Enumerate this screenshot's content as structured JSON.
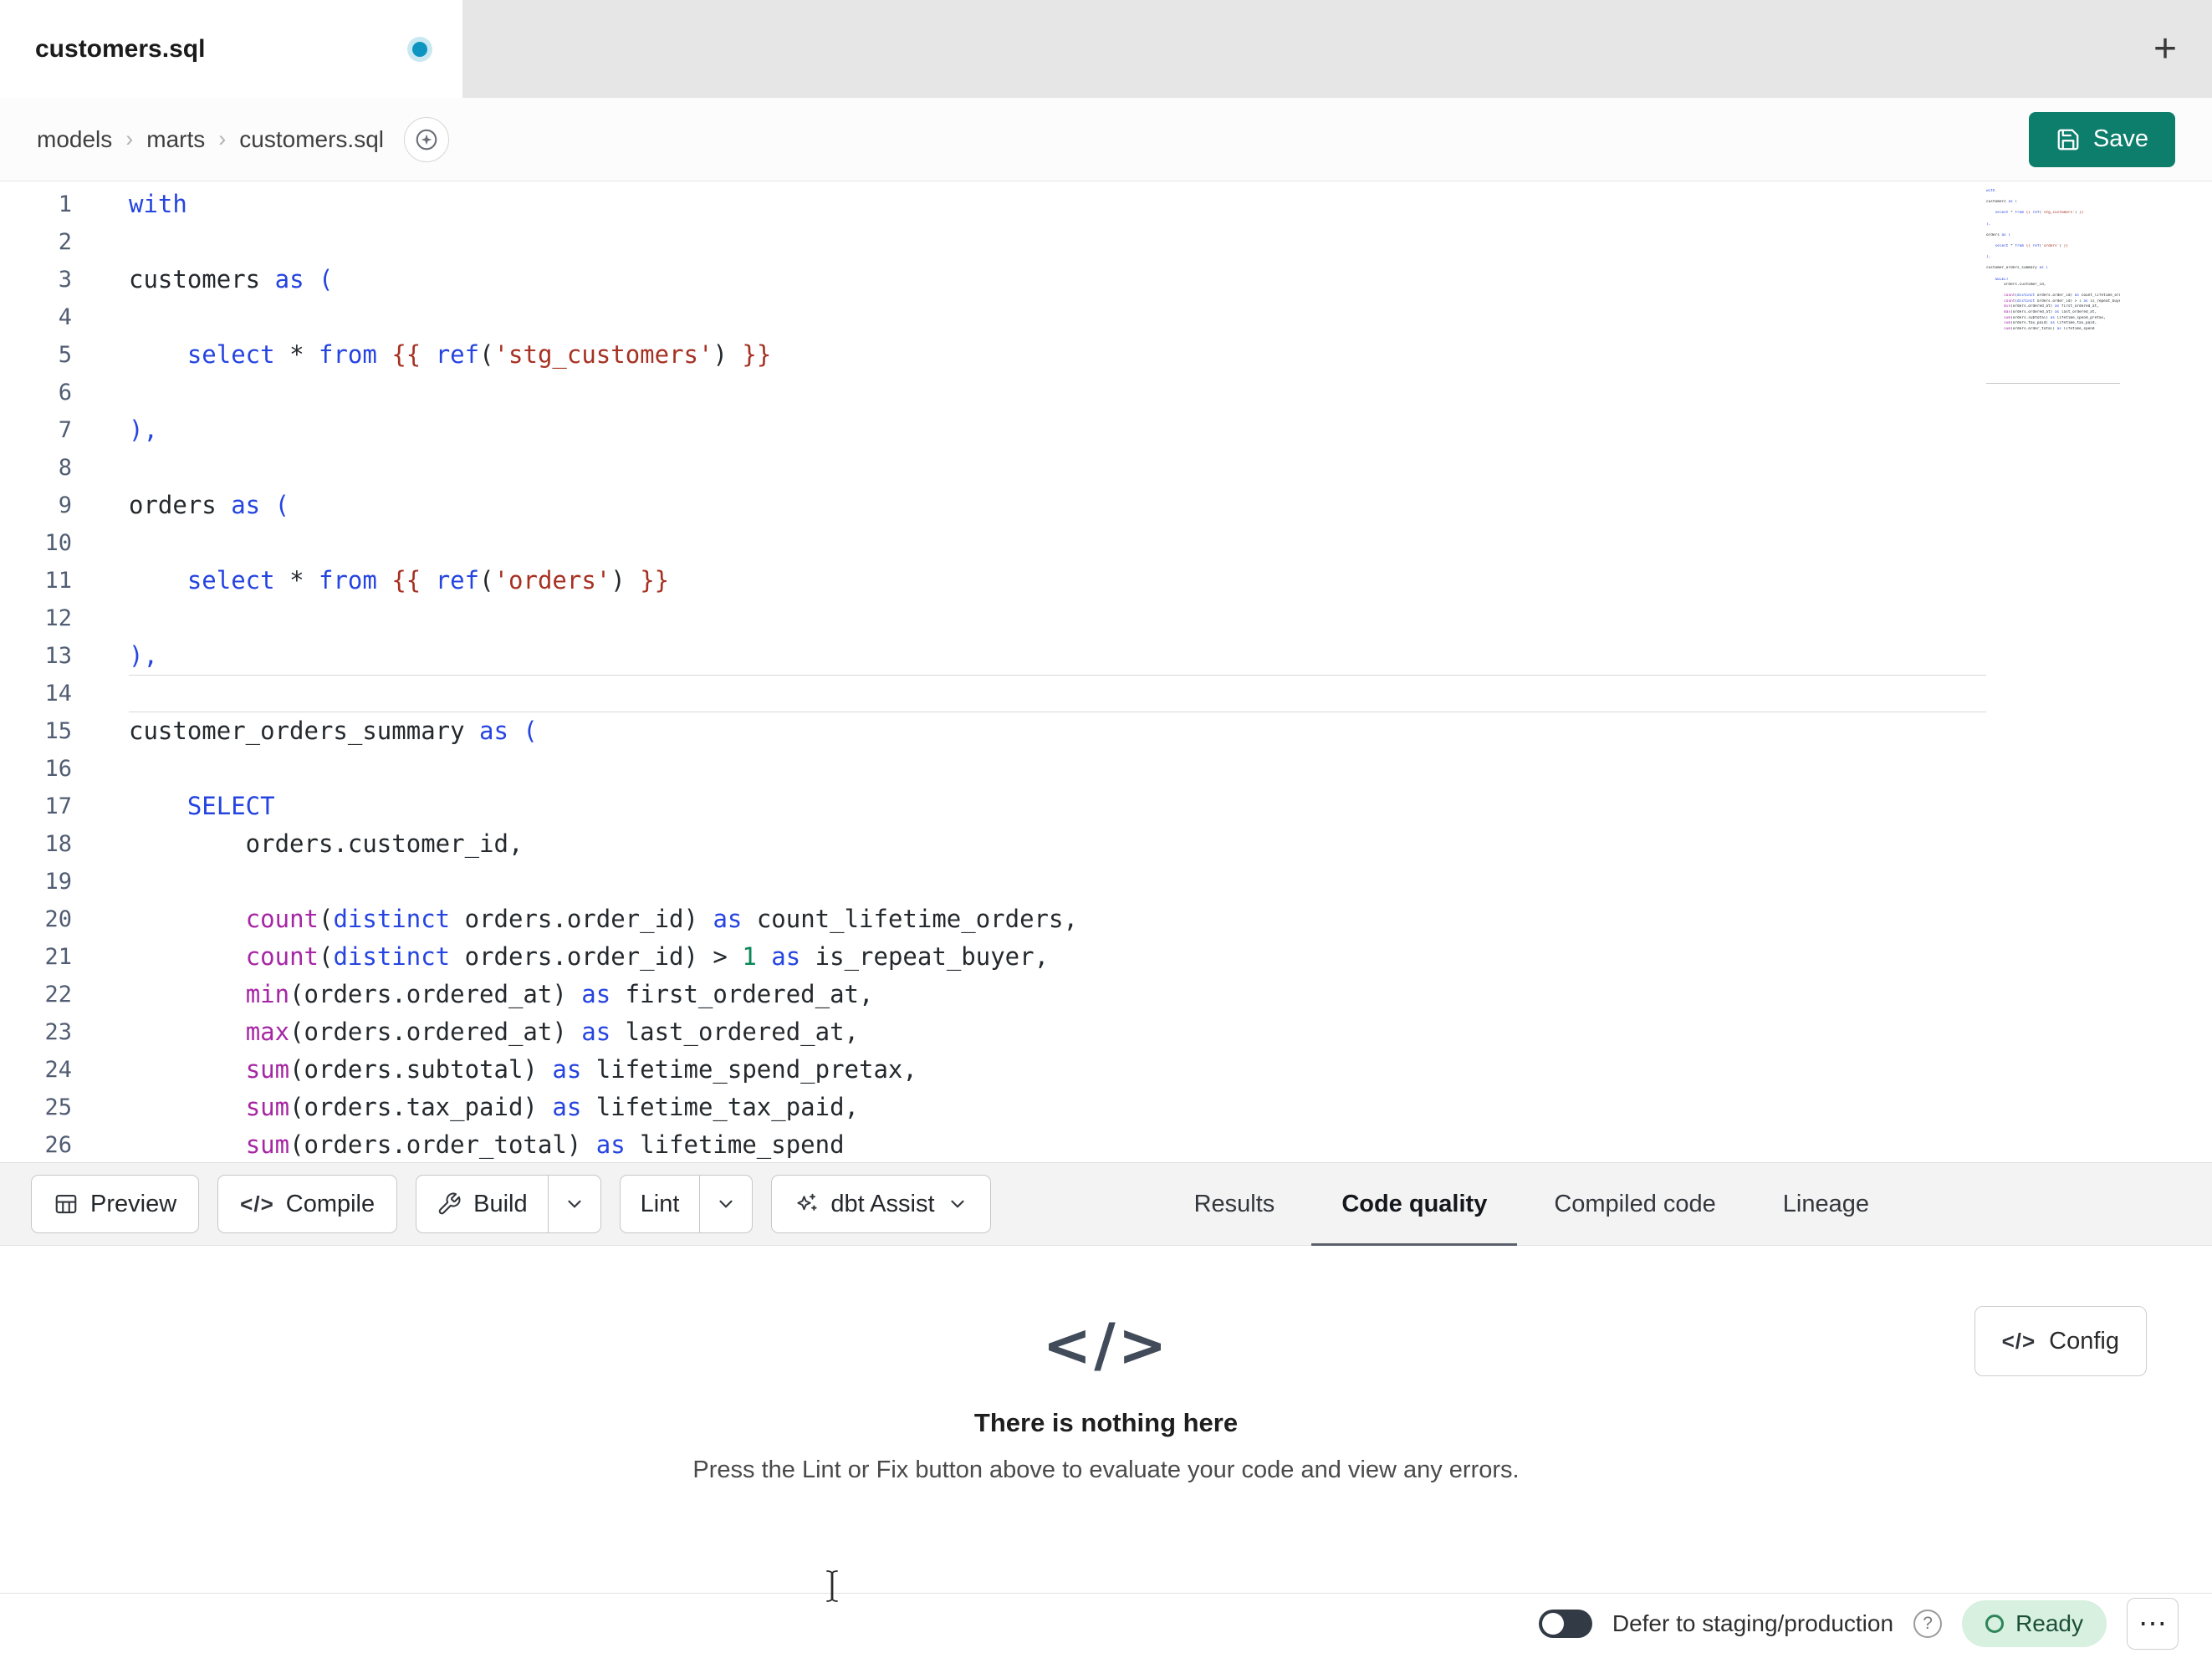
{
  "tab_bar": {
    "active_tab": "customers.sql"
  },
  "header": {
    "breadcrumb": [
      "models",
      "marts",
      "customers.sql"
    ],
    "save_label": "Save"
  },
  "icons": {
    "new_tab": "+",
    "crumb_sep": "›",
    "code_glyph": "</>",
    "empty_state_glyph": "</>",
    "ellipsis": "⋯",
    "help": "?"
  },
  "editor": {
    "active_line": 14,
    "lines": [
      {
        "tokens": [
          [
            "kw",
            "with"
          ]
        ]
      },
      {
        "tokens": []
      },
      {
        "tokens": [
          [
            "df",
            "customers "
          ],
          [
            "kw",
            "as"
          ],
          [
            "pn",
            " ("
          ]
        ]
      },
      {
        "tokens": []
      },
      {
        "tokens": [
          [
            "df",
            "    "
          ],
          [
            "kw",
            "select"
          ],
          [
            "df",
            " * "
          ],
          [
            "kw",
            "from"
          ],
          [
            "df",
            " "
          ],
          [
            "br",
            "{{"
          ],
          [
            "df",
            " "
          ],
          [
            "kw",
            "ref"
          ],
          [
            "df",
            "("
          ],
          [
            "st",
            "'stg_customers'"
          ],
          [
            "df",
            ")"
          ],
          [
            "df",
            " "
          ],
          [
            "br",
            "}}"
          ]
        ]
      },
      {
        "tokens": []
      },
      {
        "tokens": [
          [
            "pn",
            "),"
          ]
        ]
      },
      {
        "tokens": []
      },
      {
        "tokens": [
          [
            "df",
            "orders "
          ],
          [
            "kw",
            "as"
          ],
          [
            "pn",
            " ("
          ]
        ]
      },
      {
        "tokens": []
      },
      {
        "tokens": [
          [
            "df",
            "    "
          ],
          [
            "kw",
            "select"
          ],
          [
            "df",
            " * "
          ],
          [
            "kw",
            "from"
          ],
          [
            "df",
            " "
          ],
          [
            "br",
            "{{"
          ],
          [
            "df",
            " "
          ],
          [
            "kw",
            "ref"
          ],
          [
            "df",
            "("
          ],
          [
            "st",
            "'orders'"
          ],
          [
            "df",
            ")"
          ],
          [
            "df",
            " "
          ],
          [
            "br",
            "}}"
          ]
        ]
      },
      {
        "tokens": []
      },
      {
        "tokens": [
          [
            "pn",
            "),"
          ]
        ]
      },
      {
        "tokens": []
      },
      {
        "tokens": [
          [
            "df",
            "customer_orders_summary "
          ],
          [
            "kw",
            "as"
          ],
          [
            "pn",
            " ("
          ]
        ]
      },
      {
        "tokens": []
      },
      {
        "tokens": [
          [
            "df",
            "    "
          ],
          [
            "kw",
            "SELECT"
          ]
        ]
      },
      {
        "tokens": [
          [
            "df",
            "        orders.customer_id,"
          ]
        ]
      },
      {
        "tokens": []
      },
      {
        "tokens": [
          [
            "df",
            "        "
          ],
          [
            "fn",
            "count"
          ],
          [
            "df",
            "("
          ],
          [
            "kw",
            "distinct"
          ],
          [
            "df",
            " orders.order_id) "
          ],
          [
            "kw",
            "as"
          ],
          [
            "df",
            " count_lifetime_orders,"
          ]
        ]
      },
      {
        "tokens": [
          [
            "df",
            "        "
          ],
          [
            "fn",
            "count"
          ],
          [
            "df",
            "("
          ],
          [
            "kw",
            "distinct"
          ],
          [
            "df",
            " orders.order_id) > "
          ],
          [
            "nm",
            "1"
          ],
          [
            "df",
            " "
          ],
          [
            "kw",
            "as"
          ],
          [
            "df",
            " is_repeat_buyer,"
          ]
        ]
      },
      {
        "tokens": [
          [
            "df",
            "        "
          ],
          [
            "fn",
            "min"
          ],
          [
            "df",
            "(orders.ordered_at) "
          ],
          [
            "kw",
            "as"
          ],
          [
            "df",
            " first_ordered_at,"
          ]
        ]
      },
      {
        "tokens": [
          [
            "df",
            "        "
          ],
          [
            "fn",
            "max"
          ],
          [
            "df",
            "(orders.ordered_at) "
          ],
          [
            "kw",
            "as"
          ],
          [
            "df",
            " last_ordered_at,"
          ]
        ]
      },
      {
        "tokens": [
          [
            "df",
            "        "
          ],
          [
            "fn",
            "sum"
          ],
          [
            "df",
            "(orders.subtotal) "
          ],
          [
            "kw",
            "as"
          ],
          [
            "df",
            " lifetime_spend_pretax,"
          ]
        ]
      },
      {
        "tokens": [
          [
            "df",
            "        "
          ],
          [
            "fn",
            "sum"
          ],
          [
            "df",
            "(orders.tax_paid) "
          ],
          [
            "kw",
            "as"
          ],
          [
            "df",
            " lifetime_tax_paid,"
          ]
        ]
      },
      {
        "tokens": [
          [
            "df",
            "        "
          ],
          [
            "fn",
            "sum"
          ],
          [
            "df",
            "(orders.order_total) "
          ],
          [
            "kw",
            "as"
          ],
          [
            "df",
            " lifetime_spend"
          ]
        ]
      }
    ]
  },
  "toolbar": {
    "preview": "Preview",
    "compile": "Compile",
    "build": "Build",
    "lint": "Lint",
    "dbt_assist": "dbt Assist"
  },
  "panel_tabs": {
    "active": "Code quality",
    "items": [
      {
        "label": "Results"
      },
      {
        "label": "Code quality"
      },
      {
        "label": "Compiled code"
      },
      {
        "label": "Lineage"
      }
    ]
  },
  "empty_state": {
    "title": "There is nothing here",
    "subtitle": "Press the Lint or Fix button above to evaluate your code and view any errors.",
    "config_label": "Config"
  },
  "status_bar": {
    "defer_label": "Defer to staging/production",
    "ready_label": "Ready"
  },
  "colors": {
    "accent_teal": "#0e7e6c",
    "keyword": "#2544e0",
    "default_text": "#24292e",
    "punct_blue": "#2544e0",
    "jinja_delim": "#a63122",
    "string": "#a63122",
    "function": "#a626a4",
    "number": "#0a8658",
    "ready_bg": "#d7f0e0",
    "ready_text": "#1c4f38"
  }
}
